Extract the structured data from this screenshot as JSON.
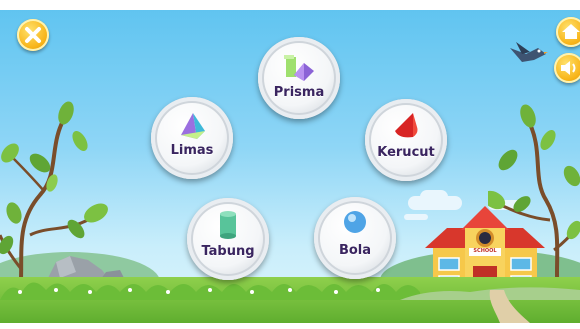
{
  "controls": {
    "close_icon": "close-icon",
    "home_icon": "home-icon",
    "sound_icon": "sound-icon"
  },
  "shapes": [
    {
      "id": "prisma",
      "label": "Prisma",
      "icon": "prism-icon"
    },
    {
      "id": "limas",
      "label": "Limas",
      "icon": "pyramid-icon"
    },
    {
      "id": "kerucut",
      "label": "Kerucut",
      "icon": "cone-icon"
    },
    {
      "id": "tabung",
      "label": "Tabung",
      "icon": "cylinder-icon"
    },
    {
      "id": "bola",
      "label": "Bola",
      "icon": "sphere-icon"
    }
  ],
  "school": {
    "sign": "SCHOOL"
  },
  "colors": {
    "accent_yellow": "#f8b51a",
    "label_purple": "#3a2560",
    "school_red": "#d8372c",
    "school_wall": "#f6c84a"
  }
}
